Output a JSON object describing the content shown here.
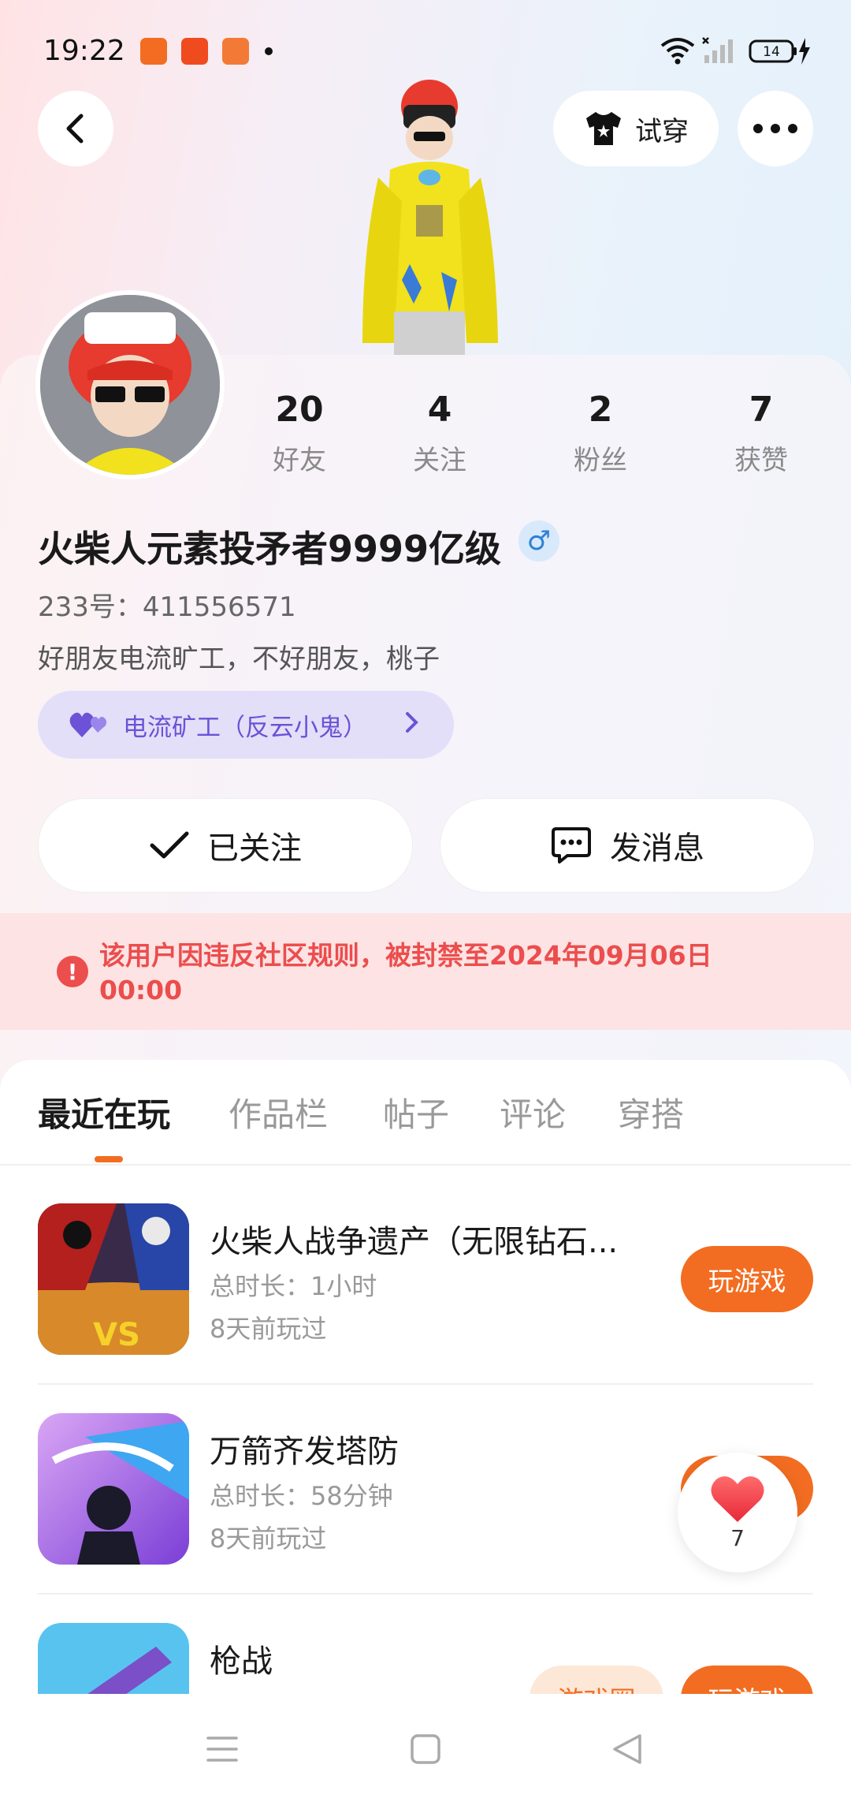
{
  "status_bar": {
    "time": "19:22",
    "battery": "14"
  },
  "header": {
    "tryon_label": "试穿"
  },
  "profile": {
    "username": "火柴人元素投矛者9999亿级",
    "gender_symbol": "♂",
    "uid": "233号：411556571",
    "bio": "好朋友电流旷工，不好朋友，桃子",
    "tag_label": "电流矿工（反云小鬼）",
    "stats": [
      {
        "value": "20",
        "label": "好友"
      },
      {
        "value": "4",
        "label": "关注"
      },
      {
        "value": "2",
        "label": "粉丝"
      },
      {
        "value": "7",
        "label": "获赞"
      }
    ]
  },
  "actions": {
    "follow_label": "已关注",
    "message_label": "发消息"
  },
  "ban_notice": "该用户因违反社区规则，被封禁至2024年09月06日 00:00",
  "tabs": [
    "最近在玩",
    "作品栏",
    "帖子",
    "评论",
    "穿搭"
  ],
  "games": [
    {
      "title": "火柴人战争遗产（无限钻石...",
      "duration": "总时长：1小时",
      "last_played": "8天前玩过",
      "button": "玩游戏"
    },
    {
      "title": "万箭齐发塔防",
      "duration": "总时长：58分钟",
      "last_played": "8天前玩过",
      "button": "玩游戏"
    },
    {
      "title": "枪战",
      "duration": "",
      "last_played": "",
      "button": "玩游戏",
      "secondary_button": "游戏圈"
    }
  ],
  "like_float": {
    "count": "7"
  },
  "colors": {
    "accent": "#f26d21",
    "ban_red": "#ec4d4d",
    "tag_purple": "#6b52d6"
  }
}
